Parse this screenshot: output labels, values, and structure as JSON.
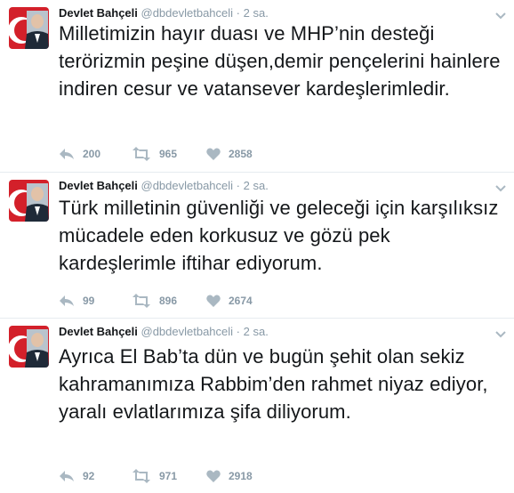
{
  "tweets": [
    {
      "name": "Devlet Bahçeli",
      "handle": "@dbdevletbahceli",
      "dot": "·",
      "time": "2 sa.",
      "text": "Milletimizin hayır duası ve MHP’nin desteği terörizmin peşine düşen,demir pençelerini hainlere indiren cesur ve vatansever kardeşlerimledir.",
      "replies": "200",
      "retweets": "965",
      "likes": "2858"
    },
    {
      "name": "Devlet Bahçeli",
      "handle": "@dbdevletbahceli",
      "dot": "·",
      "time": "2 sa.",
      "text": "Türk milletinin güvenliği ve geleceği için karşılıksız mücadele eden korkusuz ve gözü pek kardeşlerimle iftihar ediyorum.",
      "replies": "99",
      "retweets": "896",
      "likes": "2674"
    },
    {
      "name": "Devlet Bahçeli",
      "handle": "@dbdevletbahceli",
      "dot": "·",
      "time": "2 sa.",
      "text": "Ayrıca El Bab’ta dün ve bugün şehit olan sekiz kahramanımıza Rabbim’den rahmet niyaz ediyor, yaralı evlatlarımıza şifa diliyorum.",
      "replies": "92",
      "retweets": "971",
      "likes": "2918"
    }
  ],
  "icons": {
    "reply": "reply-icon",
    "retweet": "retweet-icon",
    "like": "heart-icon",
    "more": "chevron-down-icon"
  },
  "colors": {
    "icon": "#aab8c2",
    "meta": "#8899a6",
    "divider": "#e6ecf0",
    "avatar_red": "#d3202a"
  }
}
